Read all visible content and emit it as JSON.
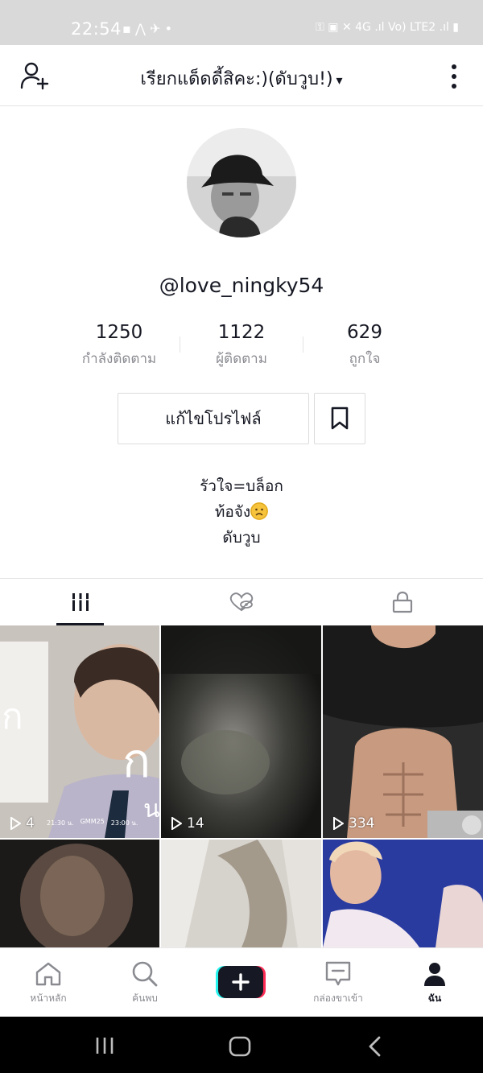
{
  "status_bar": {
    "time": "22:54",
    "left_icons": "▪ ⋀ ✈ •",
    "right_icons": "⚿ ▣ ✕ 4G .ıl Vo) LTE2 .ıl ▮"
  },
  "header": {
    "title": "เรียกแด็ดดี้สิคะ:)(ดับวูบ!)",
    "caret": "▾"
  },
  "profile": {
    "handle": "@love_ningky54",
    "stats": [
      {
        "value": "1250",
        "label": "กำลังติดตาม"
      },
      {
        "value": "1122",
        "label": "ผู้ติดตาม"
      },
      {
        "value": "629",
        "label": "ถูกใจ"
      }
    ],
    "edit_button": "แก้ไขโปรไฟล์",
    "bio_line1": "รัวใจ=บล็อก",
    "bio_line2": "ท้อจัง",
    "bio_line3": "ดับวูบ"
  },
  "videos": [
    {
      "views": "4",
      "caption_left": "21:30 น.",
      "caption_mid": "GMM25",
      "caption_right": "23:00 น."
    },
    {
      "views": "14"
    },
    {
      "views": "334"
    },
    {
      "views": ""
    },
    {
      "views": ""
    },
    {
      "views": ""
    }
  ],
  "bottom_nav": {
    "home": "หน้าหลัก",
    "discover": "ค้นพบ",
    "inbox": "กล่องขาเข้า",
    "me": "ฉัน"
  },
  "colors": {
    "text_primary": "#161823",
    "text_secondary": "#8a8b91",
    "accent_cyan": "#25f4ee",
    "accent_red": "#fe2c55"
  }
}
